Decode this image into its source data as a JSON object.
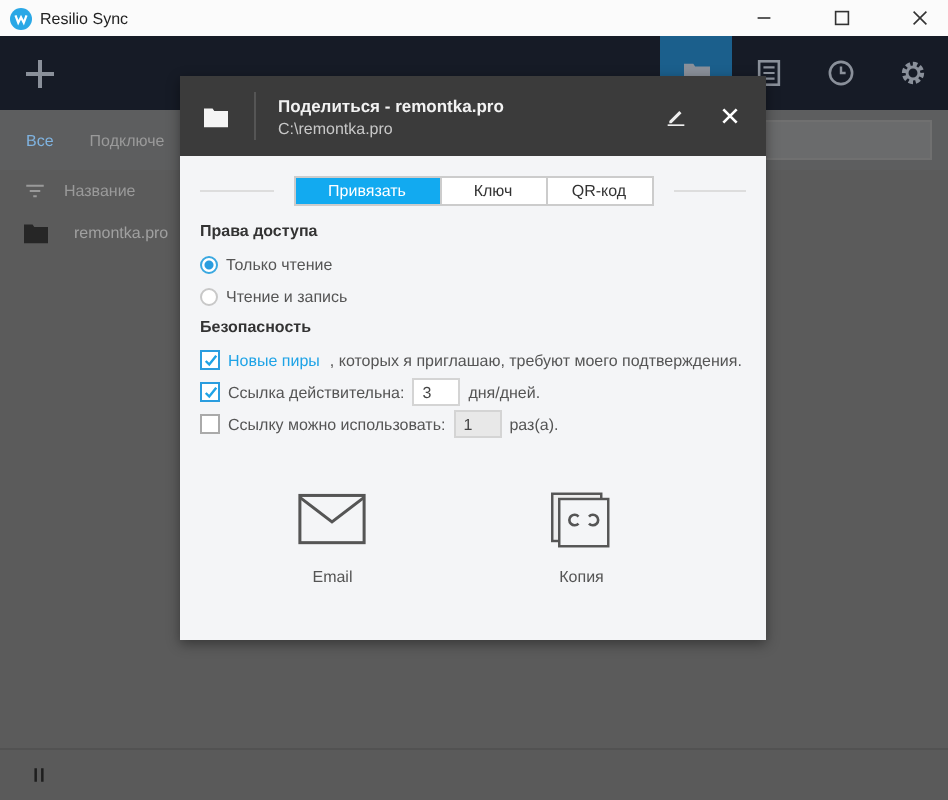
{
  "window": {
    "title": "Resilio Sync"
  },
  "nav": [
    {
      "kind": "folders",
      "selected": true
    },
    {
      "kind": "list",
      "selected": false
    },
    {
      "kind": "history",
      "selected": false
    },
    {
      "kind": "settings",
      "selected": false
    }
  ],
  "filters": [
    {
      "label": "Все",
      "selected": true
    },
    {
      "label": "Подключе",
      "selected": false
    }
  ],
  "columns": [
    "Название"
  ],
  "rows": [
    {
      "name": "remontka.pro"
    }
  ],
  "dialog": {
    "title": "Поделиться - remontka.pro",
    "path": "C:\\remontka.pro",
    "tabs": [
      {
        "label": "Привязать",
        "selected": true
      },
      {
        "label": "Ключ",
        "selected": false
      },
      {
        "label": "QR-код",
        "selected": false
      }
    ],
    "access": {
      "heading": "Права доступа",
      "options": [
        {
          "label": "Только чтение",
          "selected": true
        },
        {
          "label": "Чтение и запись",
          "selected": false
        }
      ]
    },
    "security": {
      "heading": "Безопасность",
      "items": [
        {
          "kind": "peers",
          "checked": true,
          "link": "Новые пиры",
          "text": ", которых я приглашаю, требуют моего подтверждения."
        },
        {
          "kind": "input",
          "checked": true,
          "label": "Ссылка действительна:",
          "value": "3",
          "unit": "дня/дней."
        },
        {
          "kind": "input",
          "checked": false,
          "label": "Ссылку можно использовать:",
          "value": "1",
          "unit": "раз(а)."
        }
      ]
    },
    "actions": [
      {
        "kind": "email",
        "label": "Email"
      },
      {
        "kind": "copy",
        "label": "Копия"
      }
    ]
  }
}
